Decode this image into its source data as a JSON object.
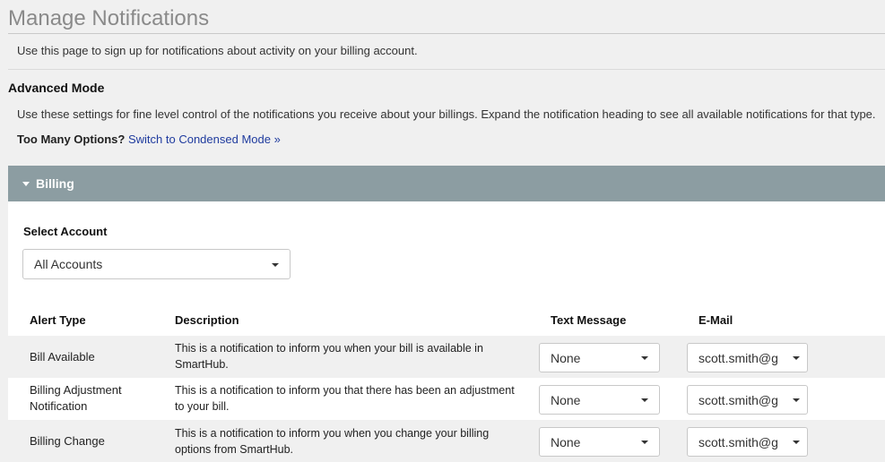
{
  "page": {
    "title": "Manage Notifications",
    "intro": "Use this page to sign up for notifications about activity on your billing account."
  },
  "advanced": {
    "heading": "Advanced Mode",
    "description": "Use these settings for fine level control of the notifications you receive about your billings. Expand the notification heading to see all available notifications for that type.",
    "too_many_label": "Too Many Options?",
    "switch_link": "Switch to Condensed Mode »"
  },
  "billing_panel": {
    "header": "Billing",
    "select_account_label": "Select Account",
    "account_value": "All Accounts",
    "columns": {
      "alert_type": "Alert Type",
      "description": "Description",
      "text_message": "Text Message",
      "email": "E-Mail"
    },
    "rows": [
      {
        "alert_type": "Bill Available",
        "description": "This is a notification to inform you when your bill is available in SmartHub.",
        "text_message": "None",
        "email": "scott.smith@g"
      },
      {
        "alert_type": "Billing Adjustment Notification",
        "description": "This is a notification to inform you that there has been an adjustment to your bill.",
        "text_message": "None",
        "email": "scott.smith@g"
      },
      {
        "alert_type": "Billing Change",
        "description": "This is a notification to inform you when you change your billing options from SmartHub.",
        "text_message": "None",
        "email": "scott.smith@g"
      }
    ]
  },
  "colors": {
    "panel_header": "#8c9da2",
    "link": "#1f3b9e",
    "title": "#8a8a8a"
  }
}
